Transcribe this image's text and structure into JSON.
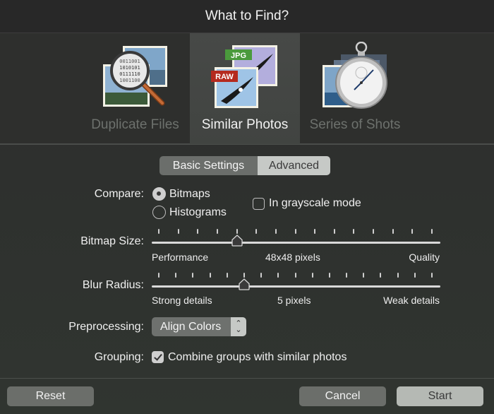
{
  "window": {
    "title": "What to Find?"
  },
  "modes": [
    {
      "id": "duplicate-files",
      "label": "Duplicate Files",
      "selected": false,
      "icon": "magnifier-binary-photos-icon"
    },
    {
      "id": "similar-photos",
      "label": "Similar Photos",
      "selected": true,
      "icon": "jpg-raw-eagle-photos-icon",
      "badges": [
        "JPG",
        "RAW"
      ]
    },
    {
      "id": "series-of-shots",
      "label": "Series of Shots",
      "selected": false,
      "icon": "stopwatch-photos-icon"
    }
  ],
  "tabs": [
    {
      "label": "Basic Settings",
      "selected": true
    },
    {
      "label": "Advanced",
      "selected": false
    }
  ],
  "compare": {
    "label": "Compare:",
    "options": [
      {
        "label": "Bitmaps",
        "selected": true
      },
      {
        "label": "Histograms",
        "selected": false
      }
    ],
    "grayscale": {
      "label": "In grayscale mode",
      "checked": false
    }
  },
  "bitmap_size": {
    "label": "Bitmap Size:",
    "min_label": "Performance",
    "value_label": "48x48 pixels",
    "max_label": "Quality",
    "ticks": 15,
    "value_index": 4
  },
  "blur_radius": {
    "label": "Blur Radius:",
    "min_label": "Strong details",
    "value_label": "5 pixels",
    "max_label": "Weak details",
    "ticks": 17,
    "value_index": 5
  },
  "preprocessing": {
    "label": "Preprocessing:",
    "value": "Align Colors"
  },
  "grouping": {
    "label": "Grouping:",
    "checkbox_label": "Combine groups with similar photos",
    "checked": true
  },
  "buttons": {
    "reset": "Reset",
    "cancel": "Cancel",
    "start": "Start"
  },
  "colors": {
    "selected_mode_bg": "#464946",
    "accent_button": "#b5b9b4",
    "jpg_badge": "#4a9a3c",
    "raw_badge": "#b52a1f"
  }
}
